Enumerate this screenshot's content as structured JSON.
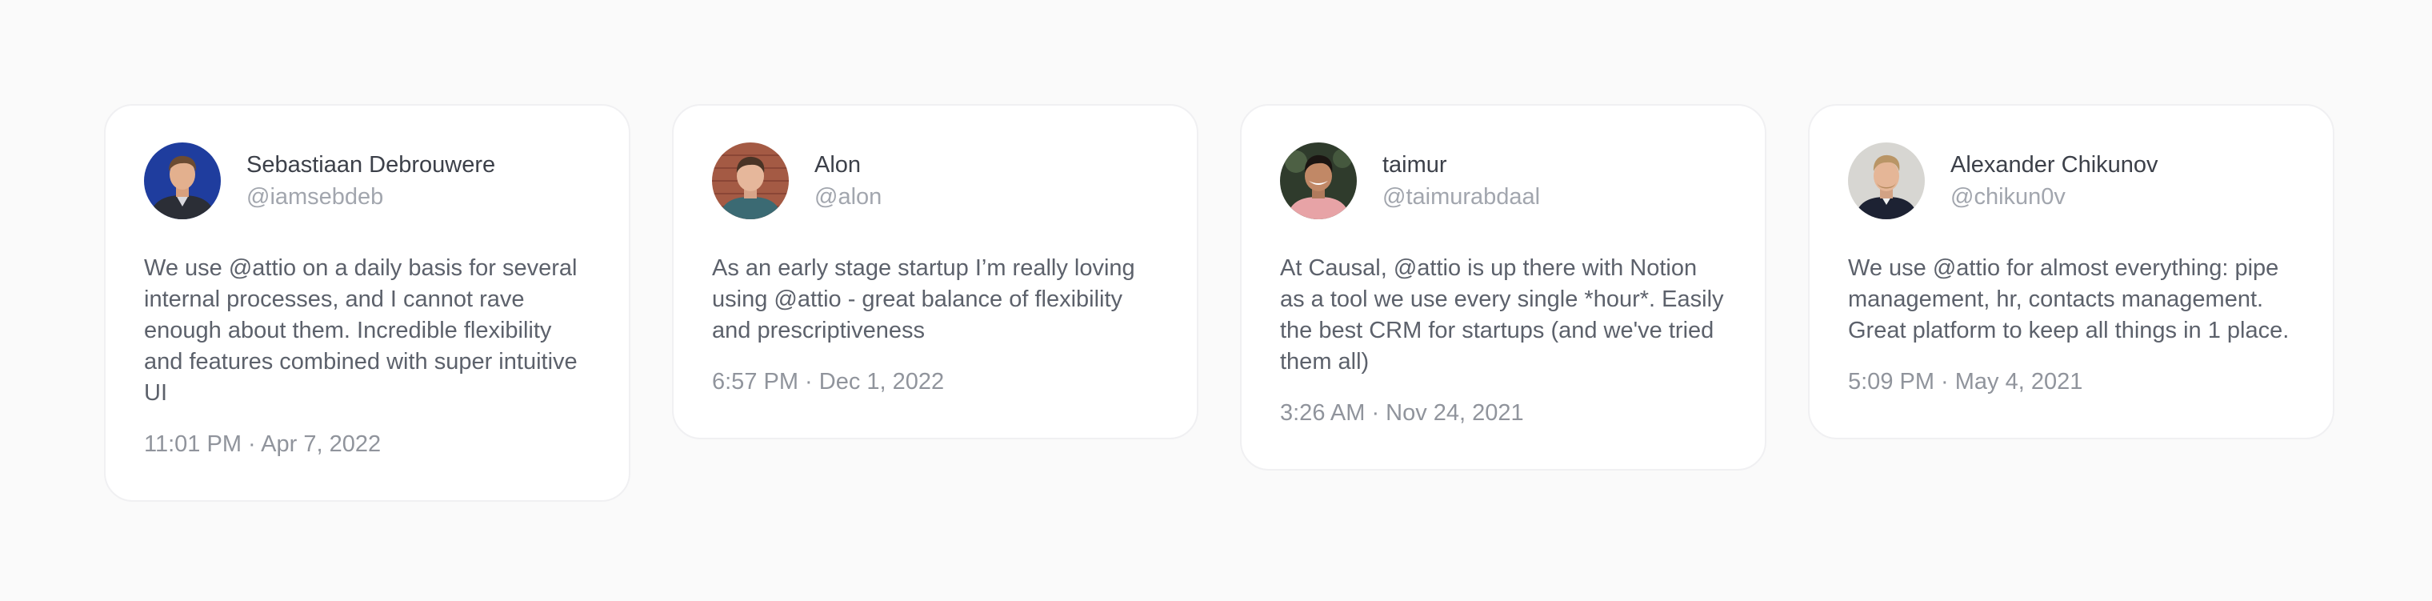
{
  "testimonials": [
    {
      "name": "Sebastiaan Debrouwere",
      "handle": "@iamsebdeb",
      "text": "We use @attio on a daily basis for several internal processes, and I cannot rave enough about them. Incredible flexibility and features combined with super intuitive UI",
      "time": "11:01 PM · Apr 7, 2022"
    },
    {
      "name": "Alon",
      "handle": "@alon",
      "text": "As an early stage startup I’m really loving using @attio - great balance of flexibility and prescriptiveness",
      "time": "6:57 PM · Dec 1, 2022"
    },
    {
      "name": "taimur",
      "handle": "@taimurabdaal",
      "text": "At Causal, @attio is up there with Notion as a tool we use every single *hour*. Easily the best CRM for startups (and we've tried them all)",
      "time": "3:26 AM · Nov 24, 2021"
    },
    {
      "name": "Alexander Chikunov",
      "handle": "@chikun0v",
      "text": "We use @attio for almost everything: pipe management, hr, contacts management. Great platform to keep all things in 1 place.",
      "time": "5:09 PM · May 4, 2021"
    }
  ]
}
